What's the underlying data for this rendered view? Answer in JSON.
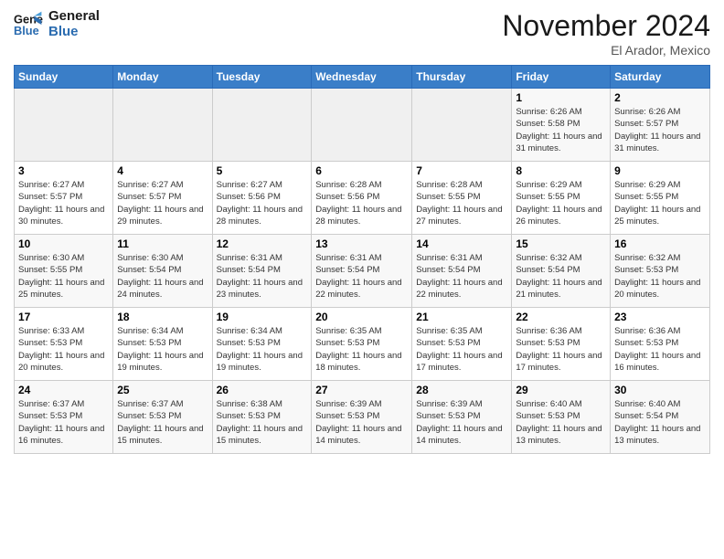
{
  "logo": {
    "line1": "General",
    "line2": "Blue"
  },
  "header": {
    "month": "November 2024",
    "location": "El Arador, Mexico"
  },
  "weekdays": [
    "Sunday",
    "Monday",
    "Tuesday",
    "Wednesday",
    "Thursday",
    "Friday",
    "Saturday"
  ],
  "weeks": [
    [
      {
        "day": "",
        "info": ""
      },
      {
        "day": "",
        "info": ""
      },
      {
        "day": "",
        "info": ""
      },
      {
        "day": "",
        "info": ""
      },
      {
        "day": "",
        "info": ""
      },
      {
        "day": "1",
        "info": "Sunrise: 6:26 AM\nSunset: 5:58 PM\nDaylight: 11 hours and 31 minutes."
      },
      {
        "day": "2",
        "info": "Sunrise: 6:26 AM\nSunset: 5:57 PM\nDaylight: 11 hours and 31 minutes."
      }
    ],
    [
      {
        "day": "3",
        "info": "Sunrise: 6:27 AM\nSunset: 5:57 PM\nDaylight: 11 hours and 30 minutes."
      },
      {
        "day": "4",
        "info": "Sunrise: 6:27 AM\nSunset: 5:57 PM\nDaylight: 11 hours and 29 minutes."
      },
      {
        "day": "5",
        "info": "Sunrise: 6:27 AM\nSunset: 5:56 PM\nDaylight: 11 hours and 28 minutes."
      },
      {
        "day": "6",
        "info": "Sunrise: 6:28 AM\nSunset: 5:56 PM\nDaylight: 11 hours and 28 minutes."
      },
      {
        "day": "7",
        "info": "Sunrise: 6:28 AM\nSunset: 5:55 PM\nDaylight: 11 hours and 27 minutes."
      },
      {
        "day": "8",
        "info": "Sunrise: 6:29 AM\nSunset: 5:55 PM\nDaylight: 11 hours and 26 minutes."
      },
      {
        "day": "9",
        "info": "Sunrise: 6:29 AM\nSunset: 5:55 PM\nDaylight: 11 hours and 25 minutes."
      }
    ],
    [
      {
        "day": "10",
        "info": "Sunrise: 6:30 AM\nSunset: 5:55 PM\nDaylight: 11 hours and 25 minutes."
      },
      {
        "day": "11",
        "info": "Sunrise: 6:30 AM\nSunset: 5:54 PM\nDaylight: 11 hours and 24 minutes."
      },
      {
        "day": "12",
        "info": "Sunrise: 6:31 AM\nSunset: 5:54 PM\nDaylight: 11 hours and 23 minutes."
      },
      {
        "day": "13",
        "info": "Sunrise: 6:31 AM\nSunset: 5:54 PM\nDaylight: 11 hours and 22 minutes."
      },
      {
        "day": "14",
        "info": "Sunrise: 6:31 AM\nSunset: 5:54 PM\nDaylight: 11 hours and 22 minutes."
      },
      {
        "day": "15",
        "info": "Sunrise: 6:32 AM\nSunset: 5:54 PM\nDaylight: 11 hours and 21 minutes."
      },
      {
        "day": "16",
        "info": "Sunrise: 6:32 AM\nSunset: 5:53 PM\nDaylight: 11 hours and 20 minutes."
      }
    ],
    [
      {
        "day": "17",
        "info": "Sunrise: 6:33 AM\nSunset: 5:53 PM\nDaylight: 11 hours and 20 minutes."
      },
      {
        "day": "18",
        "info": "Sunrise: 6:34 AM\nSunset: 5:53 PM\nDaylight: 11 hours and 19 minutes."
      },
      {
        "day": "19",
        "info": "Sunrise: 6:34 AM\nSunset: 5:53 PM\nDaylight: 11 hours and 19 minutes."
      },
      {
        "day": "20",
        "info": "Sunrise: 6:35 AM\nSunset: 5:53 PM\nDaylight: 11 hours and 18 minutes."
      },
      {
        "day": "21",
        "info": "Sunrise: 6:35 AM\nSunset: 5:53 PM\nDaylight: 11 hours and 17 minutes."
      },
      {
        "day": "22",
        "info": "Sunrise: 6:36 AM\nSunset: 5:53 PM\nDaylight: 11 hours and 17 minutes."
      },
      {
        "day": "23",
        "info": "Sunrise: 6:36 AM\nSunset: 5:53 PM\nDaylight: 11 hours and 16 minutes."
      }
    ],
    [
      {
        "day": "24",
        "info": "Sunrise: 6:37 AM\nSunset: 5:53 PM\nDaylight: 11 hours and 16 minutes."
      },
      {
        "day": "25",
        "info": "Sunrise: 6:37 AM\nSunset: 5:53 PM\nDaylight: 11 hours and 15 minutes."
      },
      {
        "day": "26",
        "info": "Sunrise: 6:38 AM\nSunset: 5:53 PM\nDaylight: 11 hours and 15 minutes."
      },
      {
        "day": "27",
        "info": "Sunrise: 6:39 AM\nSunset: 5:53 PM\nDaylight: 11 hours and 14 minutes."
      },
      {
        "day": "28",
        "info": "Sunrise: 6:39 AM\nSunset: 5:53 PM\nDaylight: 11 hours and 14 minutes."
      },
      {
        "day": "29",
        "info": "Sunrise: 6:40 AM\nSunset: 5:53 PM\nDaylight: 11 hours and 13 minutes."
      },
      {
        "day": "30",
        "info": "Sunrise: 6:40 AM\nSunset: 5:54 PM\nDaylight: 11 hours and 13 minutes."
      }
    ]
  ]
}
